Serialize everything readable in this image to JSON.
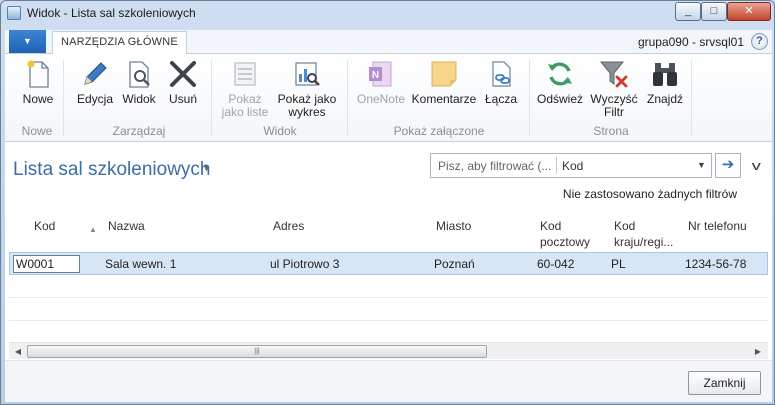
{
  "window": {
    "title": "Widok - Lista sal szkoleniowych",
    "minimize": "_",
    "maximize": "□",
    "close": "✕"
  },
  "tabs": {
    "file_glyph": "▼",
    "main_tab": "NARZĘDZIA GŁÓWNE",
    "server": "grupa090 - srvsql01",
    "help": "?"
  },
  "ribbon": {
    "buttons": [
      {
        "label": "Nowe",
        "icon": "new-document-icon",
        "enabled": true
      },
      {
        "label": "Edycja",
        "icon": "pencil-icon",
        "enabled": true
      },
      {
        "label": "Widok",
        "icon": "view-document-icon",
        "enabled": true
      },
      {
        "label": "Usuń",
        "icon": "delete-x-icon",
        "enabled": true
      },
      {
        "label": "Pokaż\njako liste",
        "icon": "list-view-icon",
        "enabled": false
      },
      {
        "label": "Pokaż jako\nwykres",
        "icon": "chart-view-icon",
        "enabled": true
      },
      {
        "label": "OneNote",
        "icon": "onenote-icon",
        "enabled": false
      },
      {
        "label": "Komentarze",
        "icon": "note-icon",
        "enabled": true
      },
      {
        "label": "Łącza",
        "icon": "link-icon",
        "enabled": true
      },
      {
        "label": "Odśwież",
        "icon": "refresh-icon",
        "enabled": true
      },
      {
        "label": "Wyczyść\nFiltr",
        "icon": "clear-filter-icon",
        "enabled": true
      },
      {
        "label": "Znajdź",
        "icon": "binoculars-icon",
        "enabled": true
      }
    ],
    "groups": [
      "Nowe",
      "Zarządzaj",
      "Widok",
      "Pokaż załączone",
      "Strona"
    ]
  },
  "page": {
    "title": "Lista sal szkoleniowych",
    "title_caret": "▼",
    "filter_placeholder": "Pisz, aby filtrować (...",
    "filter_field": "Kod",
    "filter_caret": "▼",
    "go_arrow": "➔",
    "collapse": "v",
    "filter_status": "Nie zastosowano żadnych filtrów"
  },
  "grid": {
    "columns": [
      {
        "label": "Kod"
      },
      {
        "label": "Nazwa"
      },
      {
        "label": "Adres"
      },
      {
        "label": "Miasto"
      },
      {
        "label": "Kod\npocztowy"
      },
      {
        "label": "Kod\nkraju/regi..."
      },
      {
        "label": "Nr telefonu"
      }
    ],
    "sort_arrow": "▲",
    "rows": [
      {
        "kod": "W0001",
        "nazwa": "Sala wewn. 1",
        "adres": "ul Piotrowo 3",
        "miasto": "Poznań",
        "kod_pocztowy": "60-042",
        "kraj": "PL",
        "telefon": "1234-56-78"
      }
    ]
  },
  "scrollbar": {
    "left": "◀",
    "right": "▶",
    "grip": "|||"
  },
  "footer": {
    "close_label": "Zamknij"
  },
  "colors": {
    "accent": "#3b6ea5",
    "file_tab": "#1f62b3",
    "selection": "#d7e6f7"
  }
}
